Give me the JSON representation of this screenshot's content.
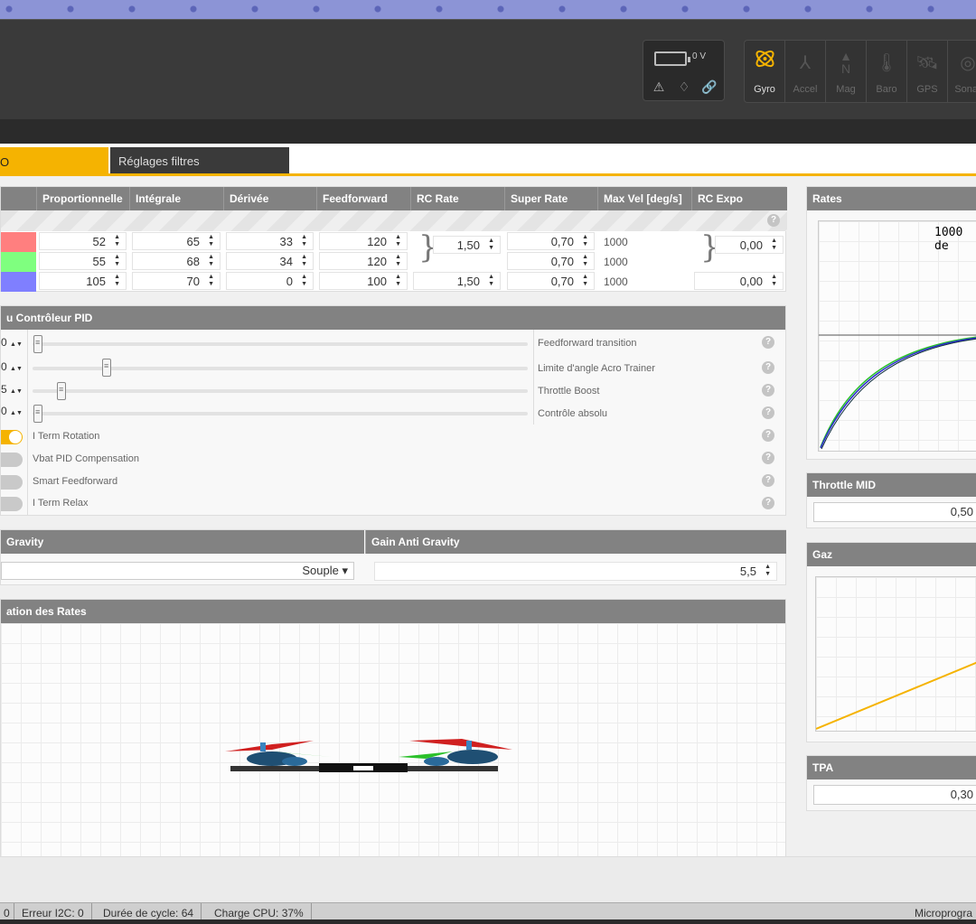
{
  "header": {
    "battery_voltage": "0 V",
    "sensors": [
      {
        "label": "Gyro",
        "icon": "gyro-icon",
        "active": true
      },
      {
        "label": "Accel",
        "icon": "accel-icon",
        "active": false
      },
      {
        "label": "Mag",
        "icon": "mag-icon",
        "active": false
      },
      {
        "label": "Baro",
        "icon": "baro-icon",
        "active": false
      },
      {
        "label": "GPS",
        "icon": "gps-icon",
        "active": false
      },
      {
        "label": "Sonar",
        "icon": "sonar-icon",
        "active": false
      }
    ]
  },
  "subtabs": {
    "active_partial": "O",
    "filters": "Réglages filtres"
  },
  "pid": {
    "columns": [
      "Proportionnelle",
      "Intégrale",
      "Dérivée",
      "Feedforward",
      "RC Rate",
      "Super Rate",
      "Max Vel [deg/s]",
      "RC Expo"
    ],
    "rows": [
      {
        "color": "#ff7f7f",
        "p": "52",
        "i": "65",
        "d": "33",
        "ff": "120",
        "super": "0,70",
        "maxvel": "1000"
      },
      {
        "color": "#7fff7f",
        "p": "55",
        "i": "68",
        "d": "34",
        "ff": "120",
        "super": "0,70",
        "maxvel": "1000"
      },
      {
        "color": "#7f7fff",
        "p": "105",
        "i": "70",
        "d": "0",
        "ff": "100",
        "rcrate": "1,50",
        "super": "0,70",
        "maxvel": "1000",
        "expo": "0,00"
      }
    ],
    "rcrate_shared": "1,50",
    "expo_shared": "0,00"
  },
  "pidctrl": {
    "title": "u Contrôleur PID",
    "sliders": [
      {
        "edge": "0",
        "label": "Feedforward transition",
        "level": 0.0
      },
      {
        "edge": "0",
        "label": "Limite d'angle Acro Trainer",
        "level": 0.15
      },
      {
        "edge": "5",
        "label": "Throttle Boost",
        "level": 0.05
      },
      {
        "edge": "0",
        "label": "Contrôle absolu",
        "level": 0.0
      }
    ],
    "toggles": [
      {
        "label": "I Term Rotation",
        "on": true
      },
      {
        "label": "Vbat PID Compensation",
        "on": false
      },
      {
        "label": "Smart Feedforward",
        "on": false
      },
      {
        "label": "I Term Relax",
        "on": false
      }
    ]
  },
  "antigravity": {
    "mode_title": "Gravity",
    "mode_value": "Souple ▾",
    "gain_title": "Gain Anti Gravity",
    "gain_value": "5,5"
  },
  "preview": {
    "title": "ation des Rates"
  },
  "rates_panel": {
    "title": "Rates",
    "overlay": "1000 de"
  },
  "throttle_mid": {
    "title": "Throttle MID",
    "value": "0,50"
  },
  "gaz": {
    "title": "Gaz"
  },
  "tpa": {
    "title": "TPA",
    "value": "0,30"
  },
  "status": {
    "first": "0",
    "i2c": "Erreur I2C: 0",
    "cycle": "Durée de cycle: 64",
    "cpu": "Charge CPU: 37%",
    "firmware": "Microprogra"
  },
  "colors": {
    "accent": "#f5b301",
    "panel_header": "#828282",
    "header_bg": "#3a3a3a"
  }
}
